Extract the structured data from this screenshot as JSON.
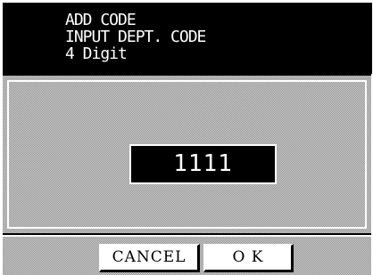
{
  "header": {
    "line1": "ADD CODE",
    "line2": "INPUT DEPT. CODE",
    "line3": "4 Digit"
  },
  "input": {
    "value": "1111"
  },
  "buttons": {
    "cancel_label": "CANCEL",
    "ok_label": "O K"
  },
  "colors": {
    "header_bg": "#000000",
    "header_text": "#ffffff",
    "panel_pattern": "#9a9a9a",
    "button_bg": "#ffffff"
  }
}
